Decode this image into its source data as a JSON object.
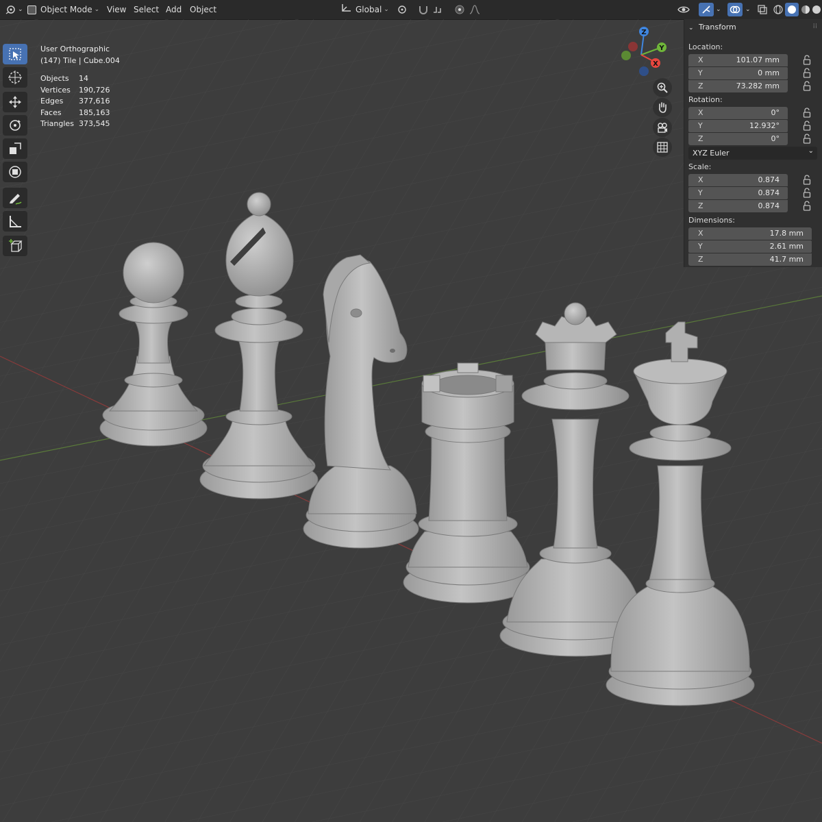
{
  "header": {
    "mode_label": "Object Mode",
    "menus": [
      "View",
      "Select",
      "Add",
      "Object"
    ],
    "transform_orientation": "Global"
  },
  "overlay": {
    "view_name": "User Orthographic",
    "object_info": "(147) Tile | Cube.004",
    "stats": [
      {
        "label": "Objects",
        "value": "14"
      },
      {
        "label": "Vertices",
        "value": "190,726"
      },
      {
        "label": "Edges",
        "value": "377,616"
      },
      {
        "label": "Faces",
        "value": "185,163"
      },
      {
        "label": "Triangles",
        "value": "373,545"
      }
    ]
  },
  "gizmo": {
    "axis_labels": [
      "Z",
      "Y",
      "X"
    ]
  },
  "sidebar": {
    "panel_title": "Transform",
    "location": {
      "label": "Location:",
      "fields": [
        {
          "axis": "X",
          "value": "101.07 mm"
        },
        {
          "axis": "Y",
          "value": "0 mm"
        },
        {
          "axis": "Z",
          "value": "73.282 mm"
        }
      ]
    },
    "rotation": {
      "label": "Rotation:",
      "fields": [
        {
          "axis": "X",
          "value": "0°"
        },
        {
          "axis": "Y",
          "value": "12.932°"
        },
        {
          "axis": "Z",
          "value": "0°"
        }
      ],
      "mode": "XYZ Euler"
    },
    "scale": {
      "label": "Scale:",
      "fields": [
        {
          "axis": "X",
          "value": "0.874"
        },
        {
          "axis": "Y",
          "value": "0.874"
        },
        {
          "axis": "Z",
          "value": "0.874"
        }
      ]
    },
    "dimensions": {
      "label": "Dimensions:",
      "fields": [
        {
          "axis": "X",
          "value": "17.8 mm"
        },
        {
          "axis": "Y",
          "value": "2.61 mm"
        },
        {
          "axis": "Z",
          "value": "41.7 mm"
        }
      ]
    }
  },
  "colors": {
    "header_bg": "#2a2a2a",
    "viewport_bg": "#3d3d3d",
    "accent": "#4772b3",
    "x_axis": "#e8473f",
    "y_axis": "#6fb63a",
    "z_axis": "#3f86e0",
    "piece": "#b0b0b0"
  },
  "pieces": [
    "pawn",
    "bishop",
    "knight",
    "rook",
    "queen",
    "king"
  ],
  "icons": [
    "editor-type-icon",
    "object-mode-icon",
    "transform-orientation-icon",
    "pivot-icon",
    "snap-icon",
    "proportional-edit-icon",
    "visibility-icon",
    "gizmo-icon",
    "overlay-icon",
    "xray-icon",
    "shading-solid-icon",
    "select-box-icon",
    "cursor-icon",
    "move-icon",
    "rotate-icon",
    "scale-icon",
    "transform-icon",
    "annotate-icon",
    "measure-icon",
    "add-cube-icon",
    "zoom-icon",
    "hand-icon",
    "camera-icon",
    "grid-icon",
    "lock-icon"
  ]
}
